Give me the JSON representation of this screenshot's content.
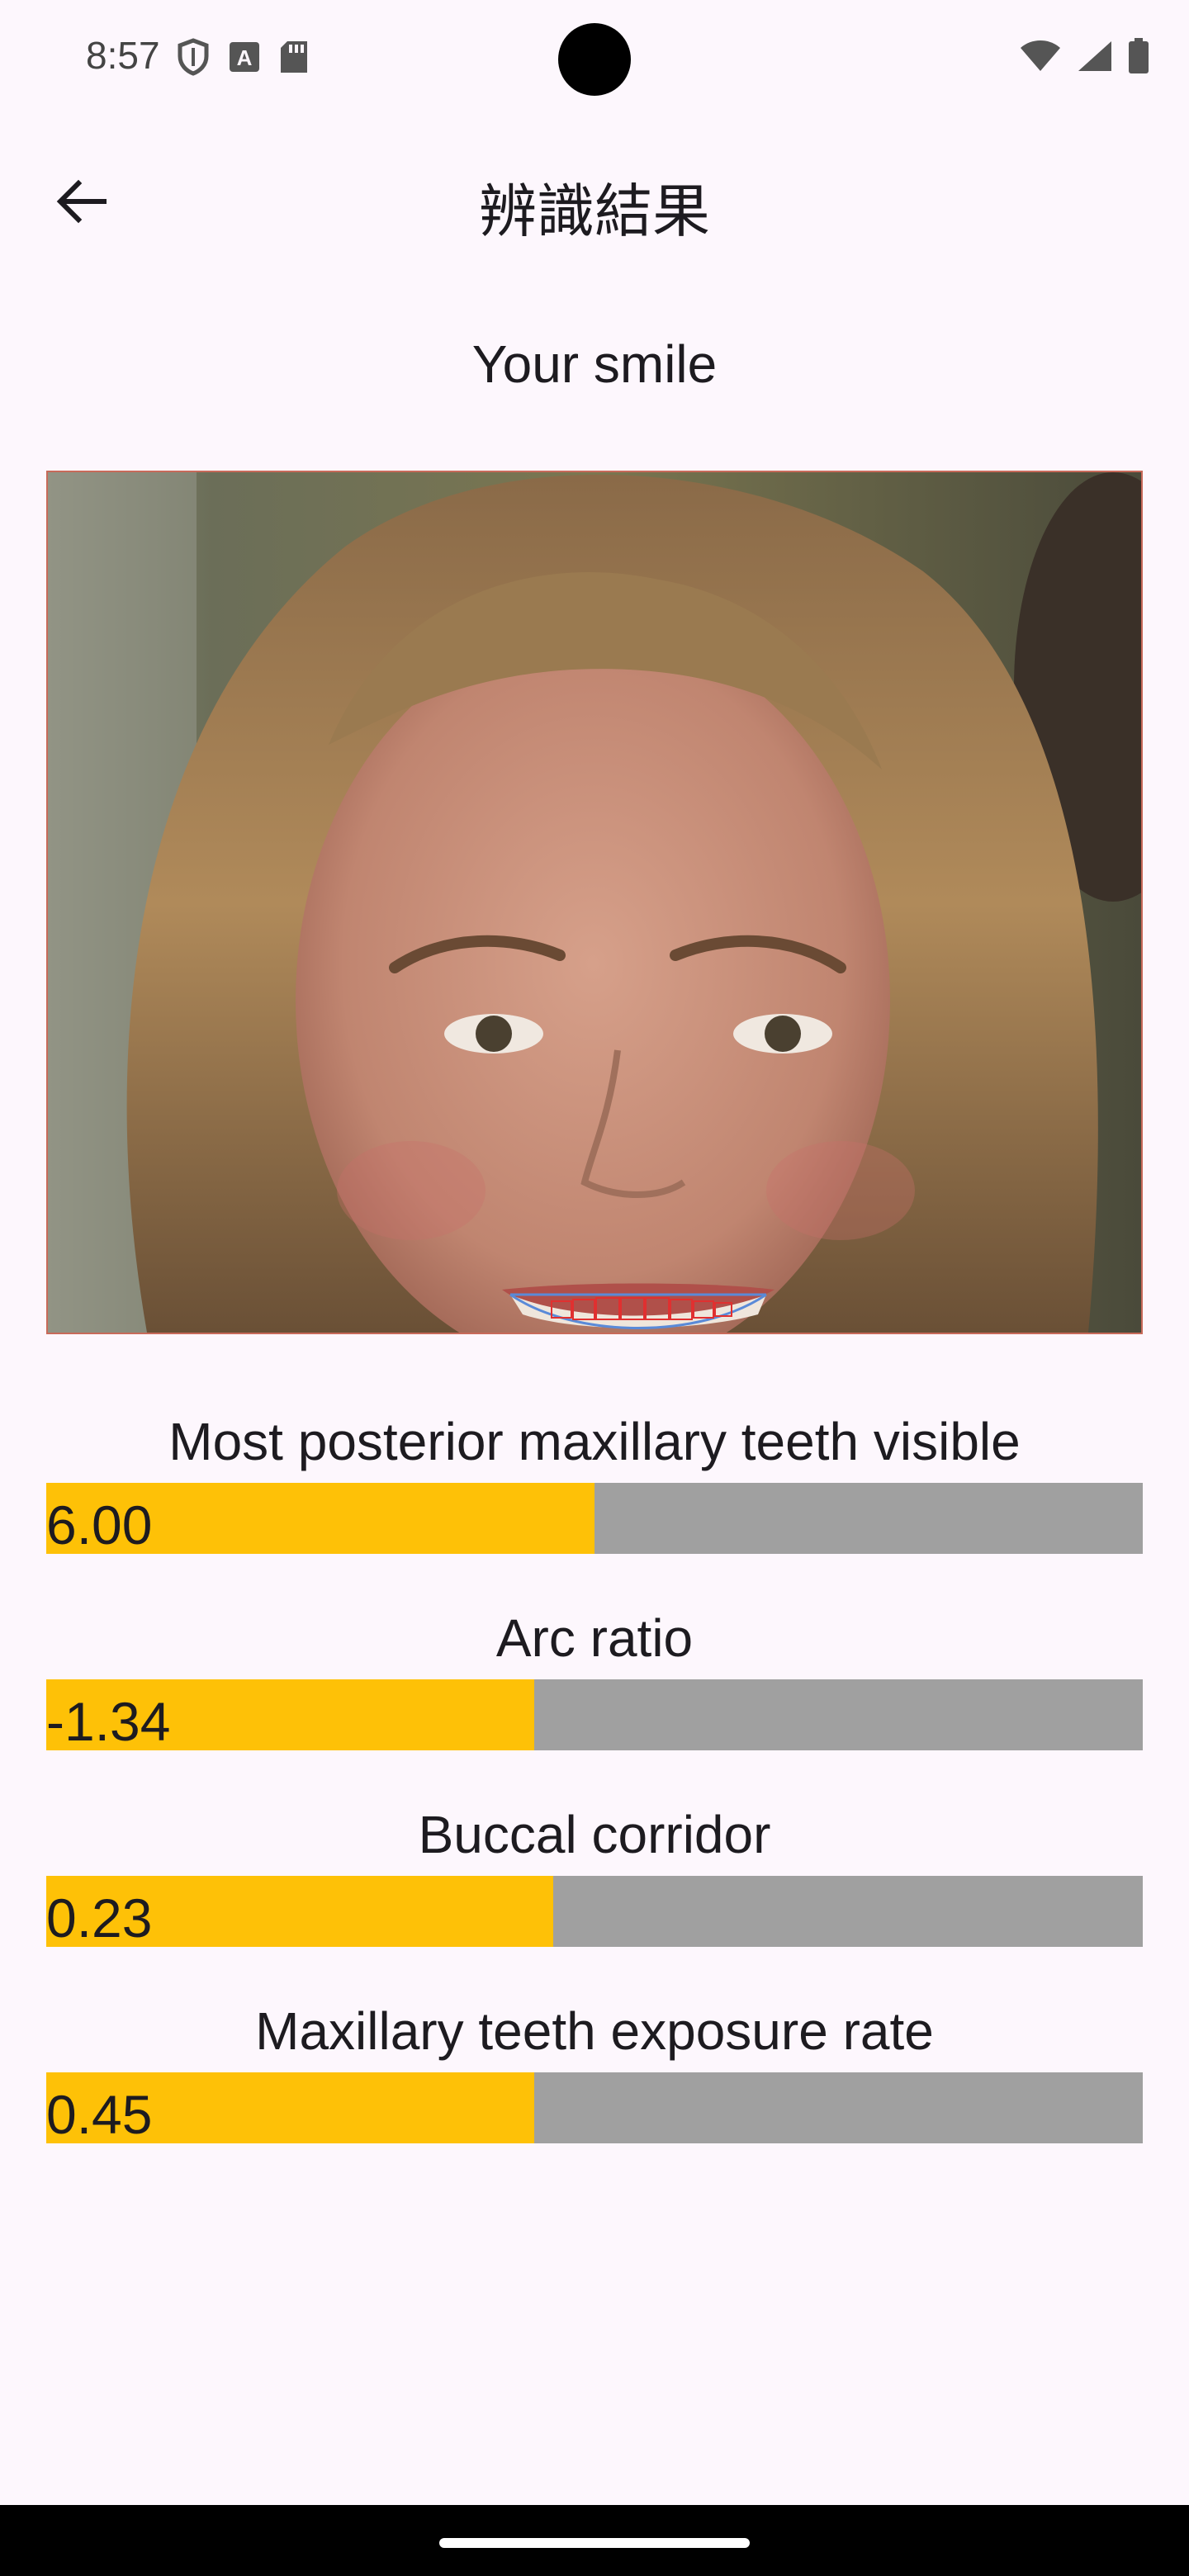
{
  "status_bar": {
    "time": "8:57",
    "left_icons": [
      "shield-icon",
      "text-a-icon",
      "sd-card-icon"
    ],
    "right_icons": [
      "wifi-icon",
      "signal-icon",
      "battery-icon"
    ]
  },
  "app_bar": {
    "back_icon": "arrow-left-icon",
    "title": "辨識結果"
  },
  "main": {
    "section_title": "Your smile",
    "photo_description_icon": "portrait-photo",
    "metrics": [
      {
        "label": "Most posterior maxillary teeth visible",
        "value": "6.00",
        "fill_fraction": 0.5
      },
      {
        "label": "Arc ratio",
        "value": "-1.34",
        "fill_fraction": 0.445
      },
      {
        "label": "Buccal corridor",
        "value": "0.23",
        "fill_fraction": 0.462
      },
      {
        "label": "Maxillary teeth exposure rate",
        "value": "0.45",
        "fill_fraction": 0.445
      }
    ]
  },
  "colors": {
    "background": "#fdf7fd",
    "bar_fill": "#fec107",
    "bar_track": "#a0a0a0",
    "text": "#1d1b20"
  }
}
